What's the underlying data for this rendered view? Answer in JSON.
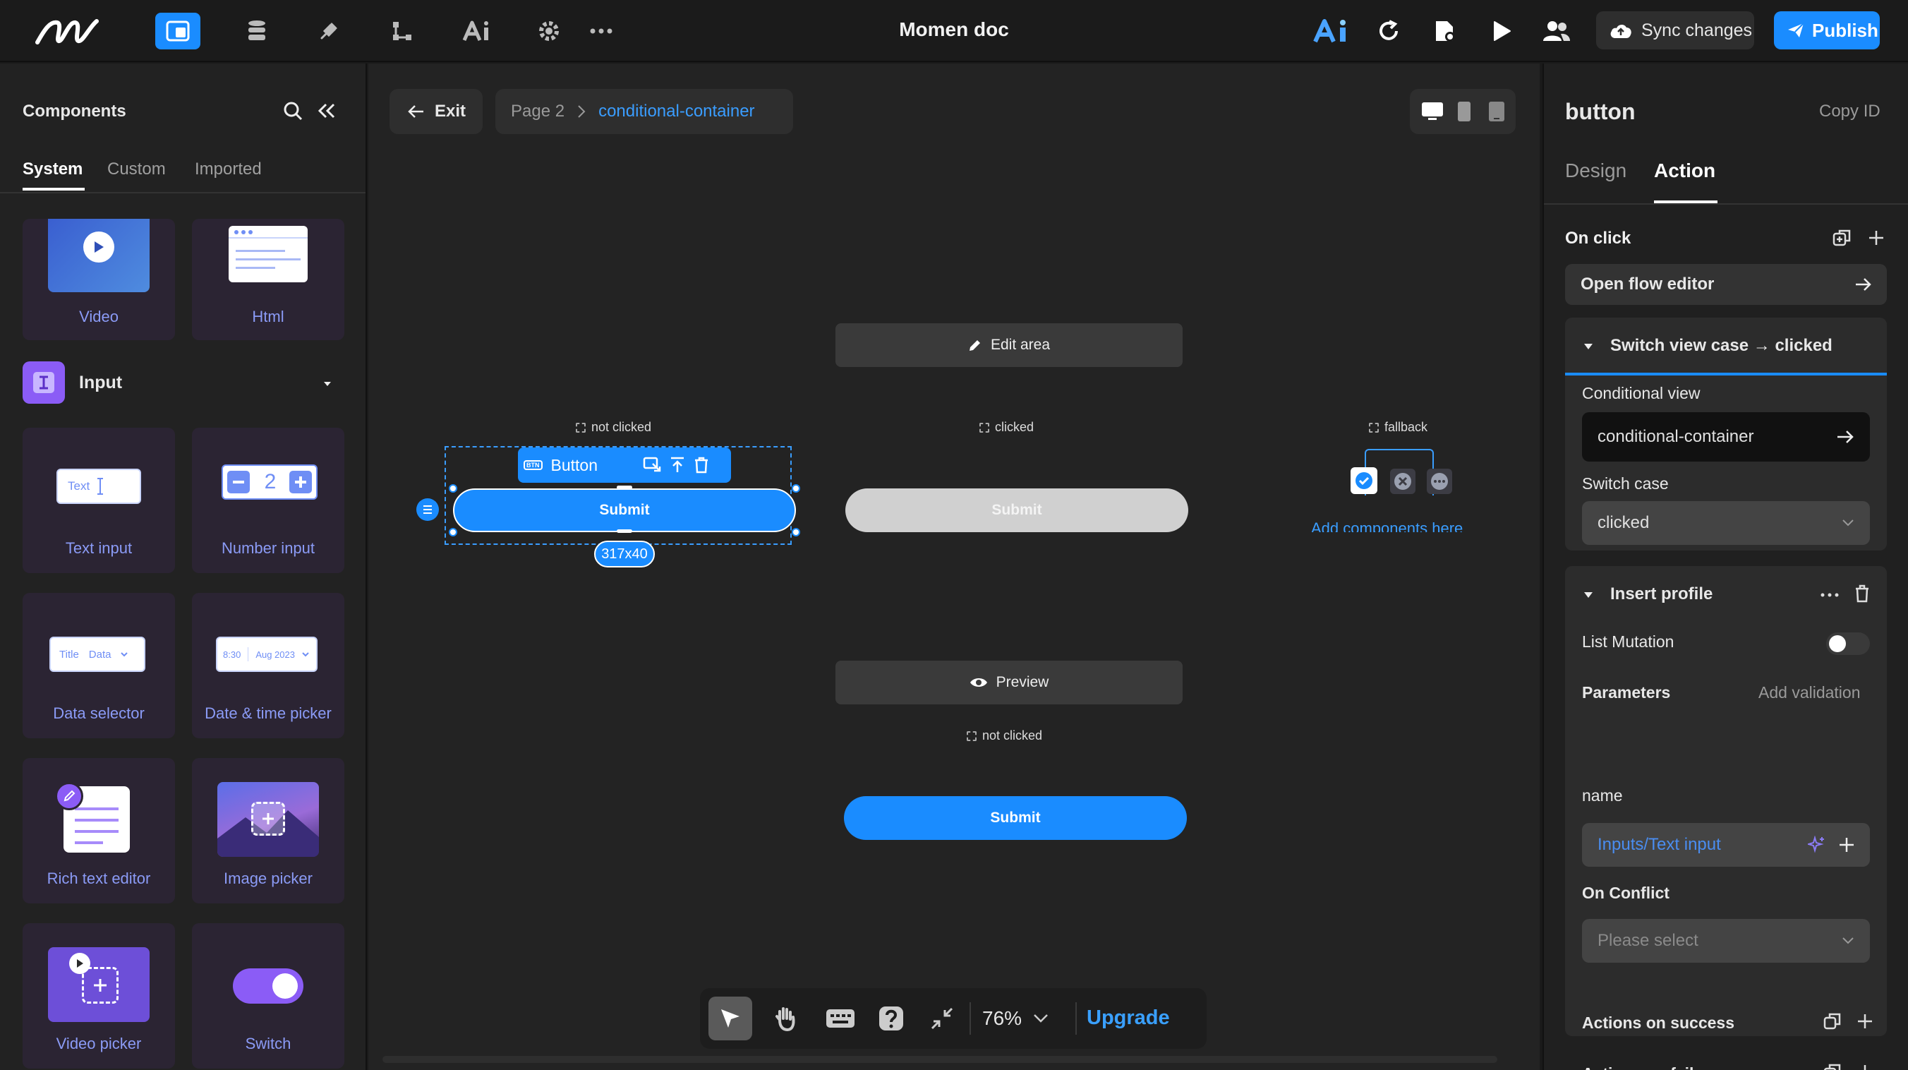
{
  "app": {
    "title": "Momen doc",
    "sync_label": "Sync changes",
    "publish_label": "Publish",
    "colors": {
      "accent": "#1a8cff",
      "bg": "#1a1a1a"
    }
  },
  "topbar": {
    "left_icons": [
      "logo-icon",
      "components-icon",
      "database-icon",
      "plugin-icon",
      "flow-icon",
      "ai-icon",
      "settings-icon",
      "more-icon"
    ],
    "right_icons": [
      "ai-assistant-icon",
      "refresh-icon",
      "page-settings-icon",
      "play-icon",
      "users-icon"
    ]
  },
  "left": {
    "title": "Components",
    "tabs": [
      {
        "label": "System",
        "active": true
      },
      {
        "label": "Custom"
      },
      {
        "label": "Imported"
      }
    ],
    "section": "Input",
    "top_cards": [
      {
        "label": "Video"
      },
      {
        "label": "Html"
      }
    ],
    "cards": [
      {
        "label": "Text input",
        "preview": "Text"
      },
      {
        "label": "Number input",
        "preview": "2"
      },
      {
        "label": "Data selector",
        "preview_a": "Title",
        "preview_b": "Data"
      },
      {
        "label": "Date & time picker",
        "preview_a": "8:30",
        "preview_b": "Aug 2023"
      },
      {
        "label": "Rich text editor"
      },
      {
        "label": "Image picker"
      },
      {
        "label": "Video picker"
      },
      {
        "label": "Switch"
      }
    ]
  },
  "canvas": {
    "exit_label": "Exit",
    "breadcrumb": {
      "page": "Page 2",
      "current": "conditional-container"
    },
    "edit_area_label": "Edit area",
    "preview_label": "Preview",
    "cases": {
      "not_clicked": "not clicked",
      "clicked": "clicked",
      "fallback": "fallback",
      "bottom": "not clicked"
    },
    "selection": {
      "component_label": "Button",
      "size_badge": "317x40"
    },
    "submit_label": "Submit",
    "add_components_text": "Add components here",
    "zoom": "76%",
    "upgrade_label": "Upgrade"
  },
  "right": {
    "title": "button",
    "copy_id": "Copy ID",
    "tabs": [
      {
        "label": "Design"
      },
      {
        "label": "Action",
        "active": true
      }
    ],
    "on_click": "On click",
    "open_flow_editor": "Open flow editor",
    "switch_card": {
      "title": "Switch view case → clicked",
      "conditional_view_label": "Conditional view",
      "conditional_view_value": "conditional-container",
      "switch_case_label": "Switch case",
      "switch_case_value": "clicked"
    },
    "insert_card": {
      "title": "Insert profile",
      "list_mutation": "List Mutation",
      "list_mutation_on": false,
      "parameters": "Parameters",
      "add_validation": "Add validation",
      "param_name": "name",
      "param_value": "Inputs/Text input",
      "on_conflict": "On Conflict",
      "on_conflict_placeholder": "Please select",
      "actions_on_success": "Actions on success",
      "actions_on_failure": "Actions on failure"
    }
  }
}
